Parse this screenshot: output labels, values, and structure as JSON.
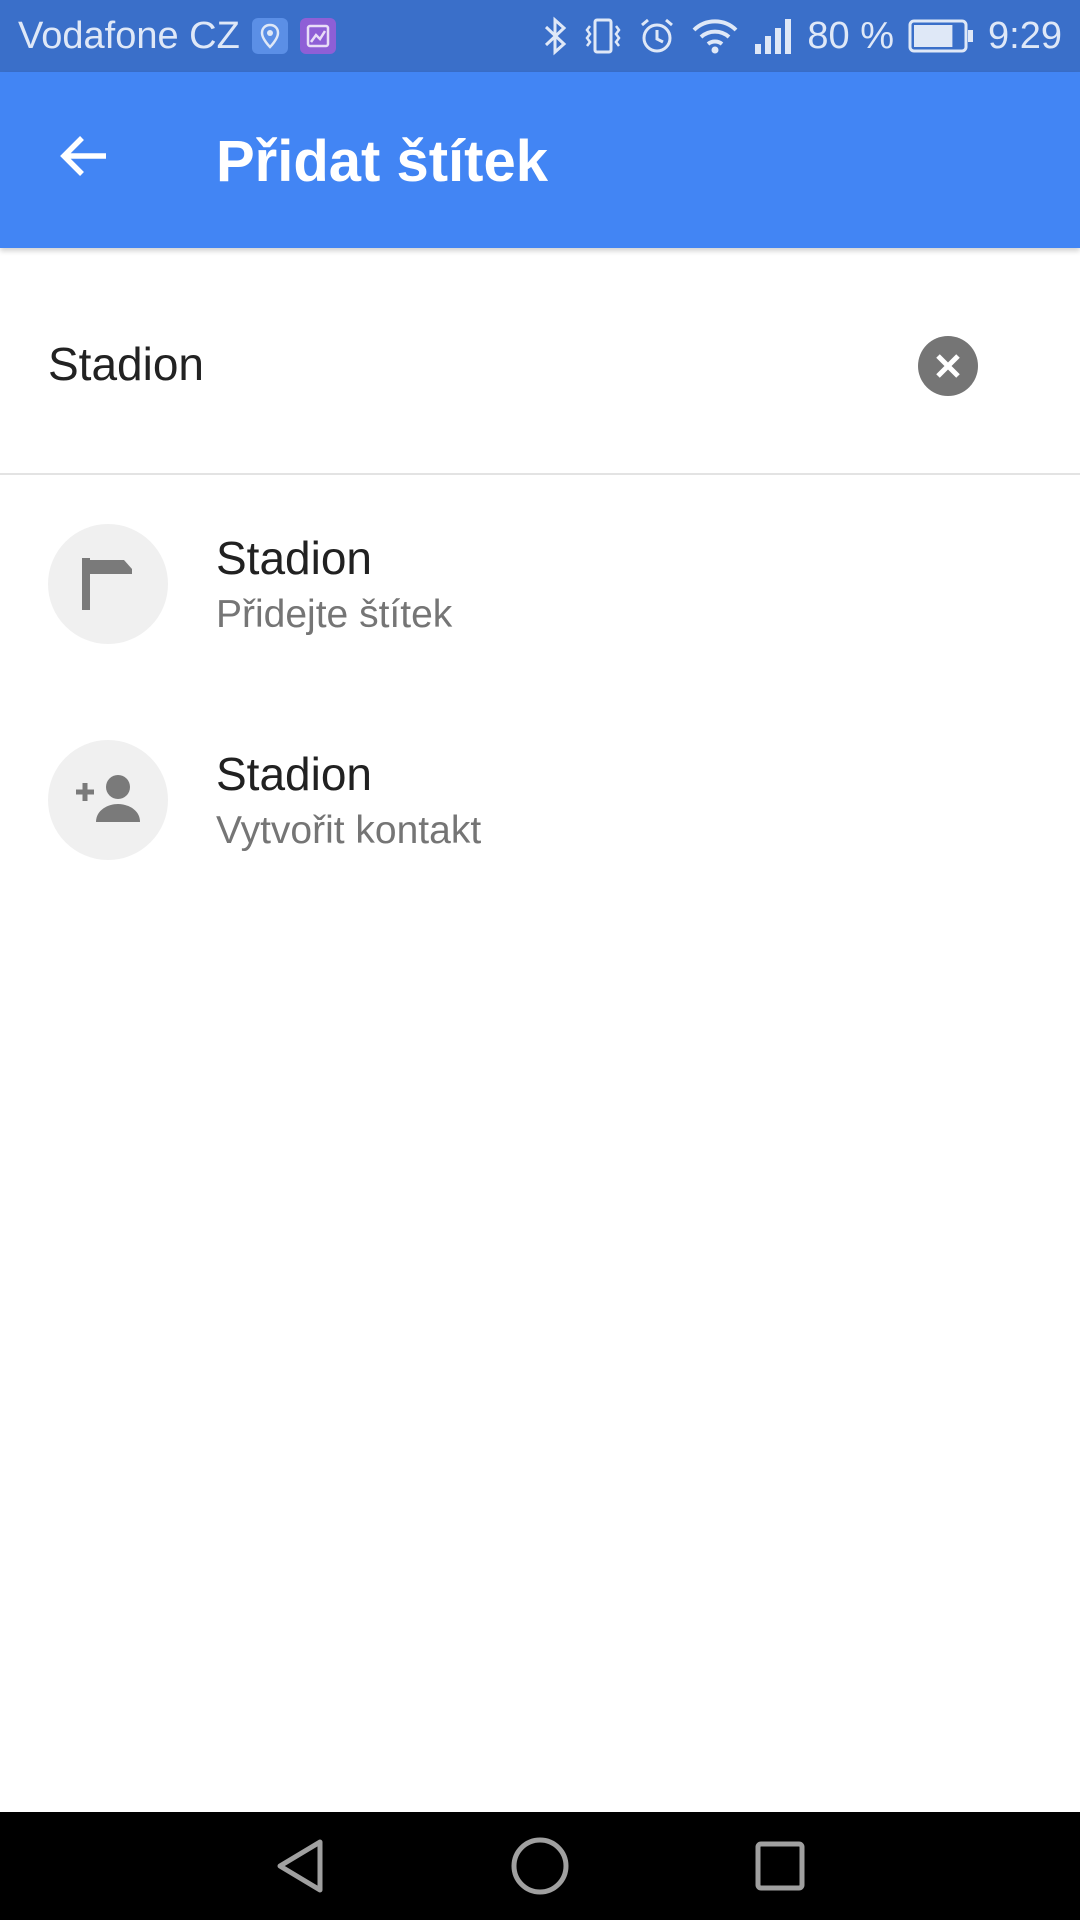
{
  "status_bar": {
    "carrier": "Vodafone CZ",
    "battery_percent": "80 %",
    "time": "9:29",
    "battery_level": 0.8,
    "icons": [
      "location-badge-icon",
      "gallery-badge-icon",
      "bluetooth-icon",
      "vibrate-icon",
      "alarm-icon",
      "wifi-icon",
      "signal-icon",
      "battery-icon"
    ]
  },
  "app_bar": {
    "title": "Přidat štítek",
    "back_icon": "arrow-back-icon",
    "background_color": "#4285f4"
  },
  "search": {
    "value": "Stadion",
    "clear_icon": "clear-circle-icon"
  },
  "suggestions": [
    {
      "title": "Stadion",
      "subtitle": "Přidejte štítek",
      "icon": "flag-icon"
    },
    {
      "title": "Stadion",
      "subtitle": "Vytvořit kontakt",
      "icon": "add-person-icon"
    }
  ],
  "nav_bar": {
    "icons": [
      "back-triangle-icon",
      "home-circle-icon",
      "recents-square-icon"
    ]
  }
}
